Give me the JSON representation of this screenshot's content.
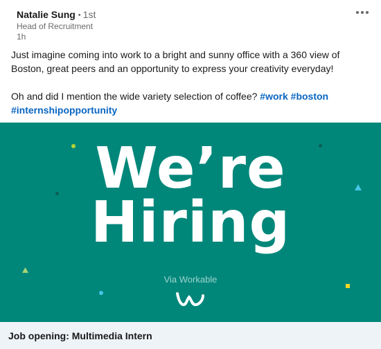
{
  "author": {
    "name": "Natalie Sung",
    "connection_degree": "1st",
    "degree_separator": "•",
    "title": "Head of Recruitment",
    "time": "1h"
  },
  "menu_icon": "more-horizontal-icon",
  "post": {
    "line1": "Just imagine coming into work to a bright and sunny office with a 360 view of Boston, great peers and an opportunity to express your creativity everyday!",
    "line2_text": "Oh and did I mention the wide variety selection of coffee?",
    "hashtags": [
      "#work",
      "#boston",
      "#internshipopportunity"
    ]
  },
  "image": {
    "headline_line1": "We’re",
    "headline_line2": "Hiring",
    "via_text": "Via Workable",
    "logo_icon": "workable-logo-icon",
    "background_color": "#00877a",
    "accent_colors": [
      "#b5d334",
      "#45c6e6",
      "#f5d523",
      "#a7d378"
    ]
  },
  "job_link": {
    "label": "Job opening: Multimedia Intern",
    "background_color": "#eef3f8"
  },
  "link_color": "#0a66c2"
}
